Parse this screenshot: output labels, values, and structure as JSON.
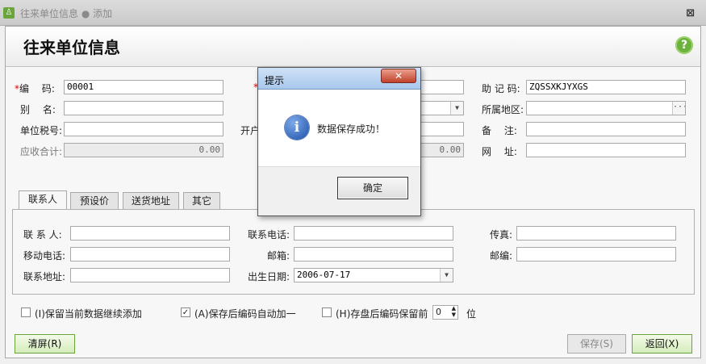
{
  "window": {
    "title": "往来单位信息 ● 添加",
    "close": "⊠"
  },
  "header": {
    "title": "往来单位信息",
    "help": "?"
  },
  "form": {
    "code_label": "编　 码:",
    "code_value": "00001",
    "alias_label": "别　 名:",
    "tax_label": "单位税号:",
    "receivable_label": "应收合计:",
    "receivable_value": "0.00",
    "bank_label": "开户",
    "mid_ro_value": "0.00",
    "mnemonic_label": "助 记 码:",
    "mnemonic_value": "ZQSSXKJYXGS",
    "region_label": "所属地区:",
    "remark_label": "备　 注:",
    "website_label": "网　 址:"
  },
  "tabs": [
    "联系人",
    "预设价",
    "送货地址",
    "其它"
  ],
  "contact": {
    "person_label": "联 系 人:",
    "phone_label": "联系电话:",
    "fax_label": "传真:",
    "mobile_label": "移动电话:",
    "email_label": "邮箱:",
    "zip_label": "邮编:",
    "address_label": "联系地址:",
    "birthday_label": "出生日期:",
    "birthday_value": "2006-07-17"
  },
  "options": {
    "keep_label": "(I)保留当前数据继续添加",
    "keep_checked": false,
    "autoinc_label": "(A)保存后编码自动加一",
    "autoinc_checked": true,
    "keepcode_label": "(H)存盘后编码保留前",
    "keepcode_checked": false,
    "digits_value": "0",
    "digits_unit": "位"
  },
  "buttons": {
    "clear": "清屏(R)",
    "save": "保存(S)",
    "back": "返回(X)"
  },
  "dialog": {
    "title": "提示",
    "close": "✕",
    "message": "数据保存成功！",
    "ok": "确定"
  }
}
